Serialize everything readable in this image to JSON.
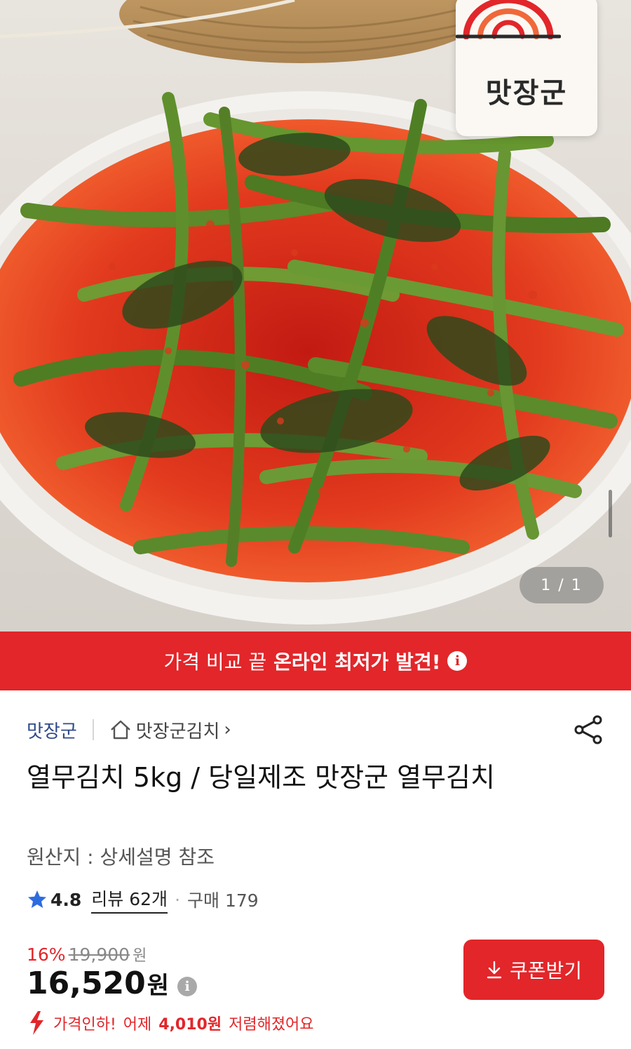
{
  "hero": {
    "brand_logo_text": "맛장군",
    "pager_text": "1 / 1",
    "image_icon": "product-photo"
  },
  "promo": {
    "lead": "가격 비교 끝",
    "strong": "온라인 최저가 발견!",
    "info_icon": "i"
  },
  "seller": {
    "name": "맛장군",
    "store_link": "맛장군김치",
    "store_chevron": "›"
  },
  "product": {
    "title": "열무김치 5kg / 당일제조 맛장군 열무김치",
    "origin": "원산지 : 상세설명 참조",
    "rating": "4.8",
    "reviews": "리뷰 62개",
    "separator": "·",
    "purchases": "구매 179"
  },
  "pricing": {
    "discount_rate": "16%",
    "original_price": "19,900",
    "original_currency": "원",
    "price": "16,520",
    "currency": "원",
    "info_icon": "i",
    "coupon_label": "쿠폰받기",
    "drop_prefix": "가격인하!",
    "drop_middle": "어제",
    "drop_amount": "4,010원",
    "drop_suffix": "저렴해졌어요"
  },
  "colors": {
    "accent_red": "#e2262a",
    "seller_blue": "#2f4a8a",
    "star_blue": "#2d6cdf"
  }
}
